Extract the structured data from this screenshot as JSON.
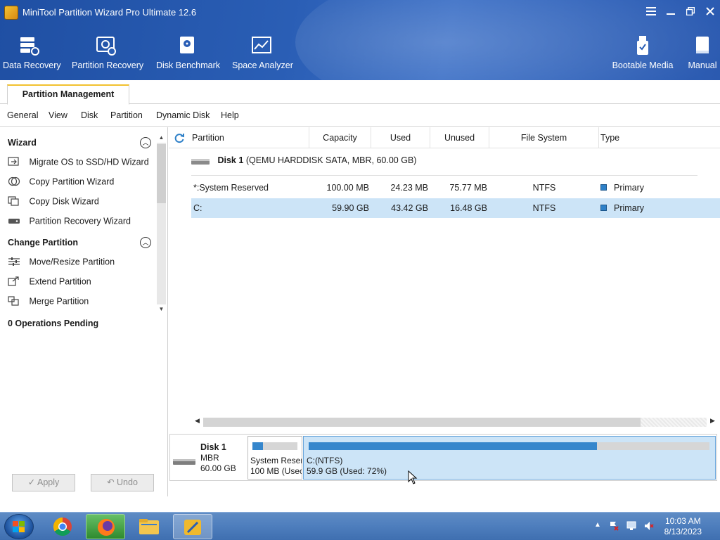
{
  "window": {
    "title": "MiniTool Partition Wizard Pro Ultimate 12.6"
  },
  "toolbar": {
    "items": [
      {
        "label": "Data Recovery",
        "icon": "data-recovery-icon"
      },
      {
        "label": "Partition Recovery",
        "icon": "partition-recovery-icon"
      },
      {
        "label": "Disk Benchmark",
        "icon": "disk-benchmark-icon"
      },
      {
        "label": "Space Analyzer",
        "icon": "space-analyzer-icon"
      },
      {
        "label": "Bootable Media",
        "icon": "bootable-media-icon"
      },
      {
        "label": "Manual",
        "icon": "manual-icon"
      }
    ]
  },
  "tabs": {
    "active": "Partition Management"
  },
  "menu": [
    "General",
    "View",
    "Disk",
    "Partition",
    "Dynamic Disk",
    "Help"
  ],
  "left_panel": {
    "wizard_title": "Wizard",
    "wizard_items": [
      "Migrate OS to SSD/HD Wizard",
      "Copy Partition Wizard",
      "Copy Disk Wizard",
      "Partition Recovery Wizard"
    ],
    "change_title": "Change Partition",
    "change_items": [
      "Move/Resize Partition",
      "Extend Partition",
      "Merge Partition"
    ],
    "pending": "0 Operations Pending",
    "apply_label": "Apply",
    "undo_label": "Undo"
  },
  "table": {
    "headers": [
      "Partition",
      "Capacity",
      "Used",
      "Unused",
      "File System",
      "Type"
    ],
    "disk": {
      "name": "Disk 1",
      "detail": "(QEMU HARDDISK SATA, MBR, 60.00 GB)"
    },
    "rows": [
      {
        "partition": "*:System Reserved",
        "capacity": "100.00 MB",
        "used": "24.23 MB",
        "unused": "75.77 MB",
        "fs": "NTFS",
        "type": "Primary",
        "selected": false
      },
      {
        "partition": "C:",
        "capacity": "59.90 GB",
        "used": "43.42 GB",
        "unused": "16.48 GB",
        "fs": "NTFS",
        "type": "Primary",
        "selected": true
      }
    ]
  },
  "disk_map": {
    "name": "Disk 1",
    "style": "MBR",
    "size": "60.00 GB",
    "partitions": [
      {
        "label1": "System Reser",
        "label2": "100 MB (Usec",
        "used_fraction": 0.24
      },
      {
        "label1": "C:(NTFS)",
        "label2": "59.9 GB (Used: 72%)",
        "used_fraction": 0.72
      }
    ]
  },
  "taskbar": {
    "time": "10:03 AM",
    "date": "8/13/2023"
  },
  "colors": {
    "accent": "#2e6fc0",
    "selection": "#cce4f7",
    "bar_fill": "#3586cc"
  }
}
